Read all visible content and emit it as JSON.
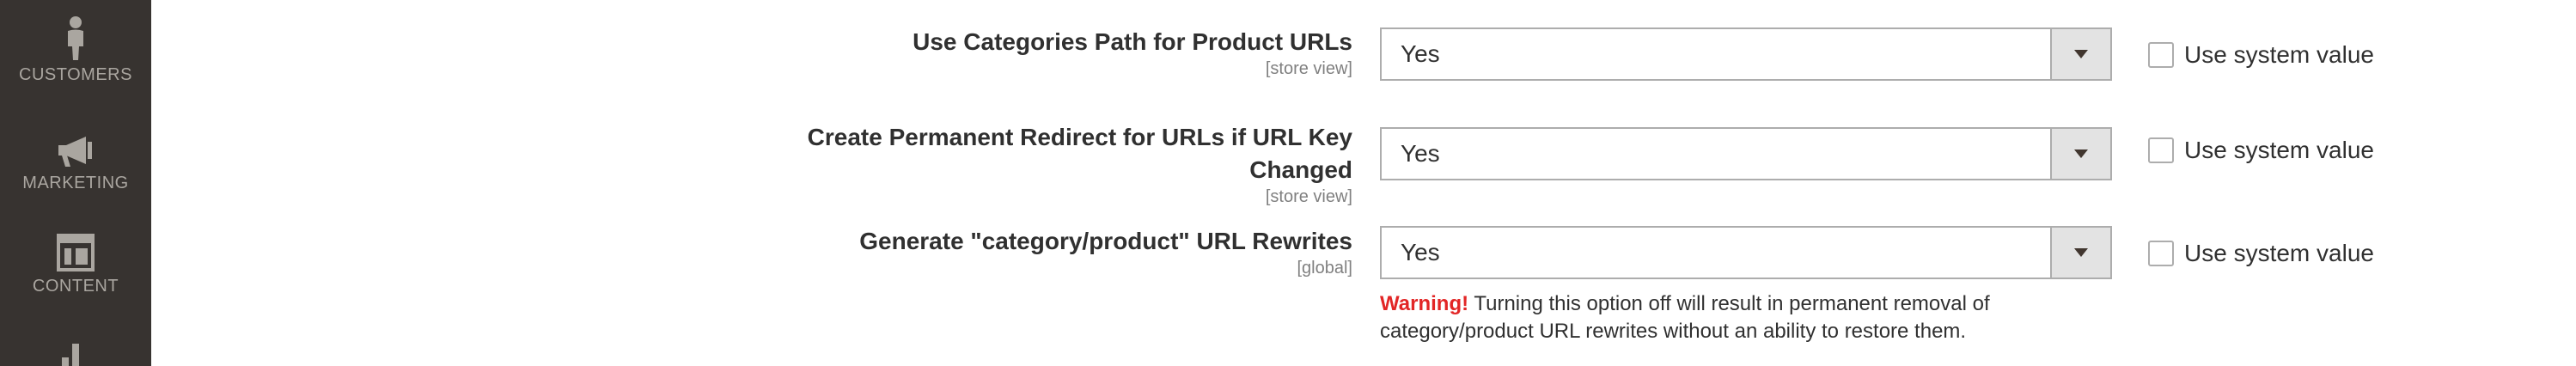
{
  "sidebar": {
    "items": [
      {
        "label": "CUSTOMERS",
        "icon": "customers-icon"
      },
      {
        "label": "MARKETING",
        "icon": "megaphone-icon"
      },
      {
        "label": "CONTENT",
        "icon": "content-layout-icon"
      },
      {
        "label": "",
        "icon": "reports-bar-icon"
      }
    ]
  },
  "config": {
    "rows": [
      {
        "label": "Use Categories Path for Product URLs",
        "scope": "[store view]",
        "value": "Yes",
        "system_value_label": "Use system value"
      },
      {
        "label_line1": "Create Permanent Redirect for URLs if URL Key",
        "label_line2": "Changed",
        "scope": "[store view]",
        "value": "Yes",
        "system_value_label": "Use system value"
      },
      {
        "label": "Generate \"category/product\" URL Rewrites",
        "scope": "[global]",
        "value": "Yes",
        "system_value_label": "Use system value"
      }
    ],
    "warning": {
      "strong": "Warning!",
      "text": " Turning this option off will result in permanent removal of category/product URL rewrites without an ability to restore them."
    }
  },
  "colors": {
    "sidebar_bg": "#373330",
    "sidebar_text": "#aaa6a0",
    "warning_red": "#e22626",
    "select_border": "#adadad",
    "select_arrow_bg": "#e3e3e3"
  }
}
